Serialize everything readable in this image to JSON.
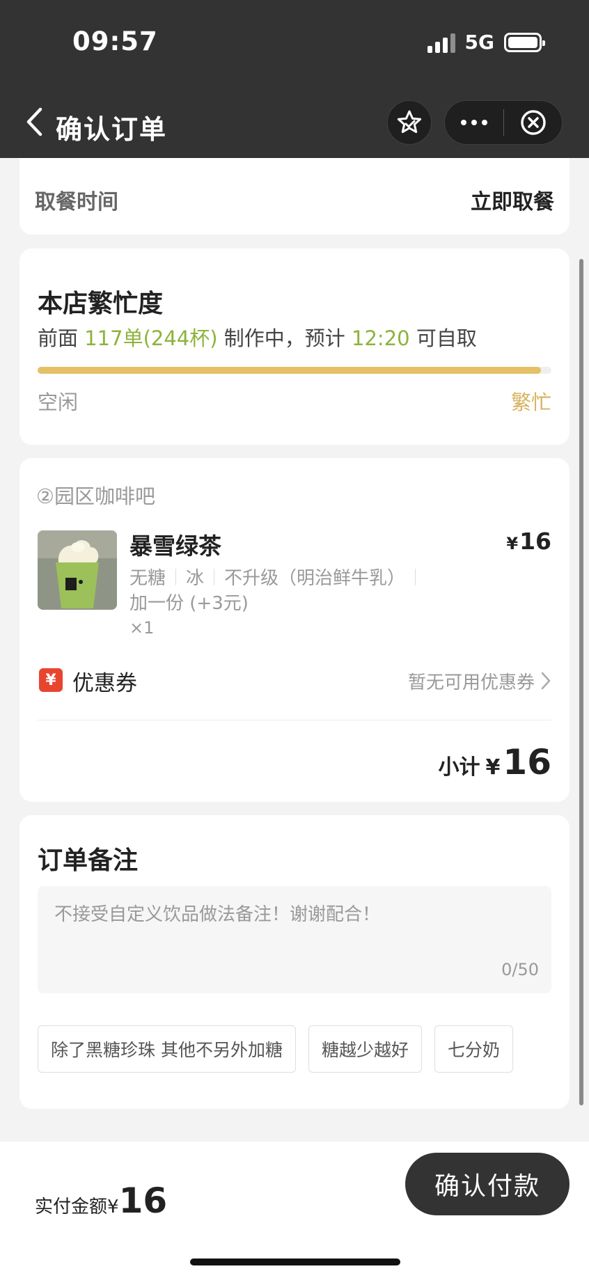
{
  "status_bar": {
    "time": "09:57",
    "network": "5G"
  },
  "nav": {
    "title": "确认订单",
    "back_icon": "chevron-left-icon",
    "favorite_icon": "star-icon",
    "more_icon": "more-icon",
    "close_icon": "close-circle-icon"
  },
  "pickup": {
    "label": "取餐时间",
    "value": "立即取餐"
  },
  "busy": {
    "title": "本店繁忙度",
    "prefix": "前面",
    "orders": "117单(244杯)",
    "middle": "制作中，预计",
    "eta": "12:20",
    "suffix": "可自取",
    "level_percent": 98,
    "low_label": "空闲",
    "high_label": "繁忙",
    "highlight_color": "#8db33b",
    "bar_color": "#e5c067"
  },
  "order": {
    "store_name": "②园区咖啡吧",
    "item": {
      "name": "暴雪绿茶",
      "price_symbol": "¥",
      "price": "16",
      "options": [
        "无糖",
        "冰",
        "不升级（明治鲜牛乳）"
      ],
      "extra": "加一份 (+3元)",
      "qty": "×1"
    },
    "coupon": {
      "icon_text": "¥",
      "label": "优惠券",
      "status": "暂无可用优惠券"
    },
    "subtotal": {
      "label": "小计",
      "symbol": "¥",
      "value": "16"
    }
  },
  "notes": {
    "title": "订单备注",
    "placeholder": "不接受自定义饮品做法备注！谢谢配合！",
    "count": "0/50",
    "chips": [
      "除了黑糖珍珠 其他不另外加糖",
      "糖越少越好",
      "七分奶"
    ]
  },
  "bottom": {
    "pay_label": "实付金额",
    "symbol": "¥",
    "amount": "16",
    "confirm_label": "确认付款"
  }
}
